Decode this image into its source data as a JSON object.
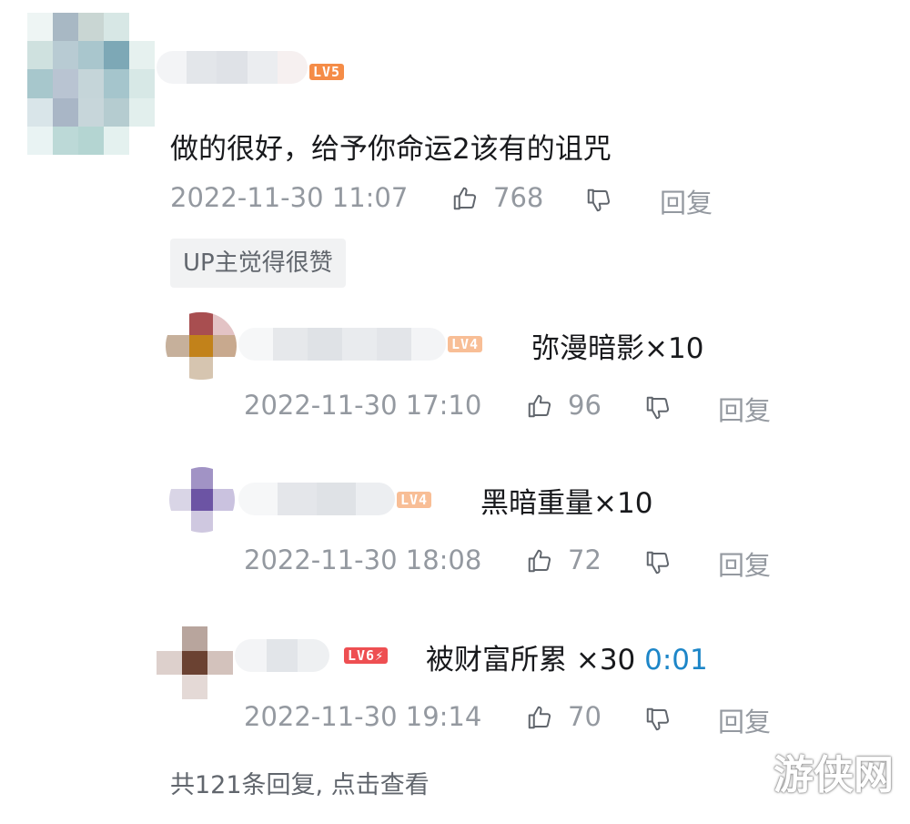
{
  "main_comment": {
    "level": "LV5",
    "level_color": "#f58c47",
    "text": "做的很好，给予你命运2该有的诅咒",
    "time": "2022-11-30 11:07",
    "likes": "768",
    "reply_label": "回复",
    "badge": "UP主觉得很赞"
  },
  "replies": [
    {
      "level": "LV4",
      "level_color": "#f8be96",
      "text": "弥漫暗影×10",
      "time": "2022-11-30 17:10",
      "likes": "96",
      "reply_label": "回复"
    },
    {
      "level": "LV4",
      "level_color": "#f8be96",
      "text": "黑暗重量×10",
      "time": "2022-11-30 18:08",
      "likes": "72",
      "reply_label": "回复"
    },
    {
      "level": "LV6⚡",
      "level_color": "#ee4f52",
      "text": "被财富所累 ×30 ",
      "timestamp_link": "0:01",
      "time": "2022-11-30 19:14",
      "likes": "70",
      "reply_label": "回复"
    }
  ],
  "more_replies": "共121条回复, 点击查看",
  "watermark": "游侠网",
  "icons": [
    "like-icon",
    "dislike-icon"
  ],
  "colors": {
    "meta": "#9499a0",
    "link": "#1d86c8",
    "text": "#18191c"
  }
}
